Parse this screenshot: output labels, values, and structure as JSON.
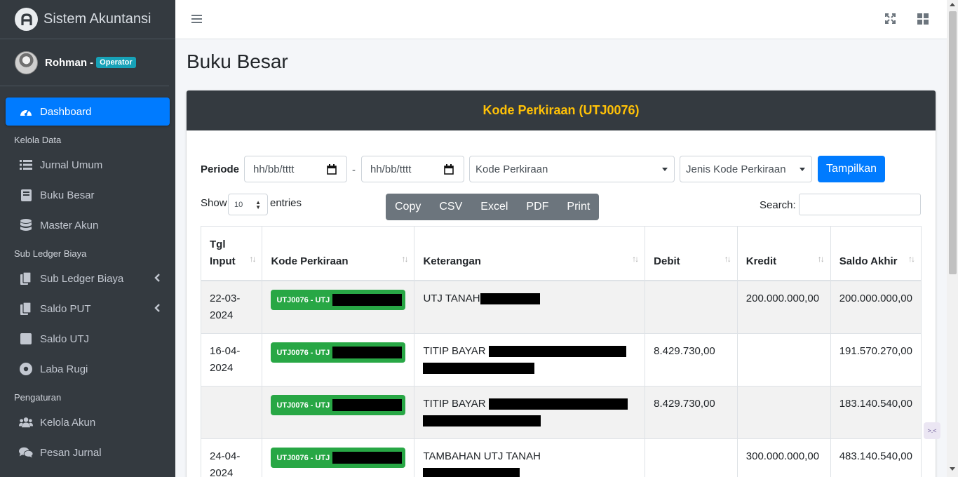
{
  "app": {
    "brand": "Sistem Akuntansi"
  },
  "user": {
    "name": "Rohman -",
    "role": "Operator"
  },
  "sidebar": {
    "items": [
      {
        "label": "Dashboard",
        "icon": "tachometer-icon",
        "active": true
      },
      {
        "header": "Kelola Data"
      },
      {
        "label": "Jurnal Umum",
        "icon": "list-icon"
      },
      {
        "label": "Buku Besar",
        "icon": "book-icon"
      },
      {
        "label": "Master Akun",
        "icon": "database-icon"
      },
      {
        "header": "Sub Ledger Biaya"
      },
      {
        "label": "Sub Ledger Biaya",
        "icon": "copy-icon",
        "expandable": true
      },
      {
        "label": "Saldo PUT",
        "icon": "copy-icon",
        "expandable": true
      },
      {
        "label": "Saldo UTJ",
        "icon": "square-icon"
      },
      {
        "label": "Laba Rugi",
        "icon": "dot-circle-icon"
      },
      {
        "header": "Pengaturan"
      },
      {
        "label": "Kelola Akun",
        "icon": "users-icon"
      },
      {
        "label": "Pesan Jurnal",
        "icon": "comments-icon"
      }
    ]
  },
  "page": {
    "title": "Buku Besar"
  },
  "card": {
    "header": "Kode Perkiraan (UTJ0076)"
  },
  "filter": {
    "periode_label": "Periode",
    "date_from_placeholder": "hh/bb/tttt",
    "date_to_placeholder": "hh/bb/tttt",
    "separator": "-",
    "kode_select": "Kode Perkiraan",
    "jenis_select": "Jenis Kode Perkiraan",
    "submit_label": "Tampilkan"
  },
  "datatable": {
    "show_label": "Show",
    "entries_value": "10",
    "entries_label": "entries",
    "buttons": [
      "Copy",
      "CSV",
      "Excel",
      "PDF",
      "Print"
    ],
    "search_label": "Search:"
  },
  "table": {
    "headers": [
      "Tgl Input",
      "Kode Perkiraan",
      "Keterangan",
      "Debit",
      "Kredit",
      "Saldo Akhir"
    ],
    "rows": [
      {
        "tgl": "22-03-2024",
        "kode": "UTJ0076 - UTJ",
        "keterangan": "UTJ TANAH",
        "debit": "",
        "kredit": "200.000.000,00",
        "saldo": "200.000.000,00"
      },
      {
        "tgl": "16-04-2024",
        "kode": "UTJ0076 - UTJ",
        "keterangan": "TITIP BAYAR",
        "debit": "8.429.730,00",
        "kredit": "",
        "saldo": "191.570.270,00"
      },
      {
        "tgl": "",
        "kode": "UTJ0076 - UTJ",
        "keterangan": "TITIP BAYAR",
        "debit": "8.429.730,00",
        "kredit": "",
        "saldo": "183.140.540,00"
      },
      {
        "tgl": "24-04-2024",
        "kode": "UTJ0076 - UTJ",
        "keterangan": "TAMBAHAN UTJ TANAH",
        "debit": "",
        "kredit": "300.000.000,00",
        "saldo": "483.140.540,00"
      }
    ]
  },
  "colors": {
    "sidebar": "#343a40",
    "primary": "#007bff",
    "header_accent": "#ffc107",
    "badge_green": "#28a745",
    "role_badge": "#17a2b8"
  }
}
